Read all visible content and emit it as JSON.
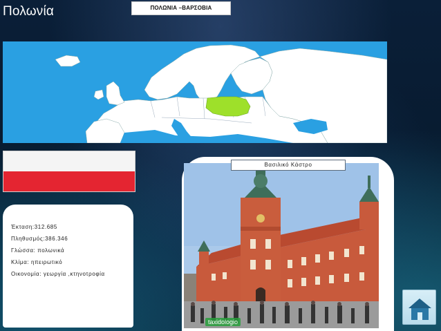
{
  "slide": {
    "title": "Πολωνία",
    "banner": "ΠΟΛΩΝΙΑ –ΒΑΡΣΟΒΙΑ"
  },
  "facts": [
    "Έκταση:312.685",
    "Πληθυσμός:386.346",
    "Γλώσσα: πολωνικά",
    "Κλίμα: ηπειρωτικό",
    "Οικονομία: γεωργία ,κτηνοτροφία"
  ],
  "photo": {
    "caption": "Βασιλικό Κάστρο",
    "watermark": "taxidologio"
  },
  "colors": {
    "sea": "#2aa0e2",
    "land": "#ffffff",
    "highlight": "#9ee02a",
    "flag_white": "#f4f4f4",
    "flag_red": "#e42531"
  },
  "icons": {
    "home": "home-icon"
  }
}
